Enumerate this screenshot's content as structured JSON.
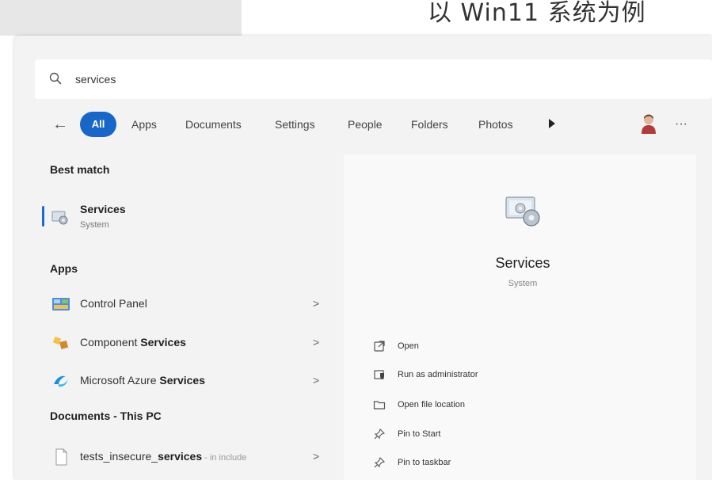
{
  "caption": "以 Win11 系统为例",
  "search": {
    "value": "services",
    "placeholder": ""
  },
  "tabs": [
    {
      "label": "All"
    },
    {
      "label": "Apps"
    },
    {
      "label": "Documents"
    },
    {
      "label": "Settings"
    },
    {
      "label": "People"
    },
    {
      "label": "Folders"
    },
    {
      "label": "Photos"
    }
  ],
  "sections": {
    "best_match": "Best match",
    "apps": "Apps",
    "documents": "Documents - This PC"
  },
  "best_match": {
    "title": "Services",
    "subtitle": "System"
  },
  "apps": [
    {
      "prefix": "Control Panel",
      "bold": "",
      "icon": "control-panel-icon"
    },
    {
      "prefix": "Component ",
      "bold": "Services",
      "icon": "component-services-icon"
    },
    {
      "prefix": "Microsoft Azure ",
      "bold": "Services",
      "icon": "azure-icon"
    }
  ],
  "documents": [
    {
      "prefix": "tests_insecure_",
      "bold": "services",
      "suffix": " - in include",
      "icon": "document-icon"
    }
  ],
  "chevron": ">",
  "detail": {
    "title": "Services",
    "subtitle": "System"
  },
  "actions": [
    {
      "label": "Open",
      "icon": "open-icon"
    },
    {
      "label": "Run as administrator",
      "icon": "shield-admin-icon"
    },
    {
      "label": "Open file location",
      "icon": "folder-icon"
    },
    {
      "label": "Pin to Start",
      "icon": "pin-icon"
    },
    {
      "label": "Pin to taskbar",
      "icon": "pin-icon"
    }
  ],
  "colors": {
    "accent": "#1867c8",
    "panel_bg": "#f3f3f3",
    "detail_bg": "#f9f9f9"
  }
}
